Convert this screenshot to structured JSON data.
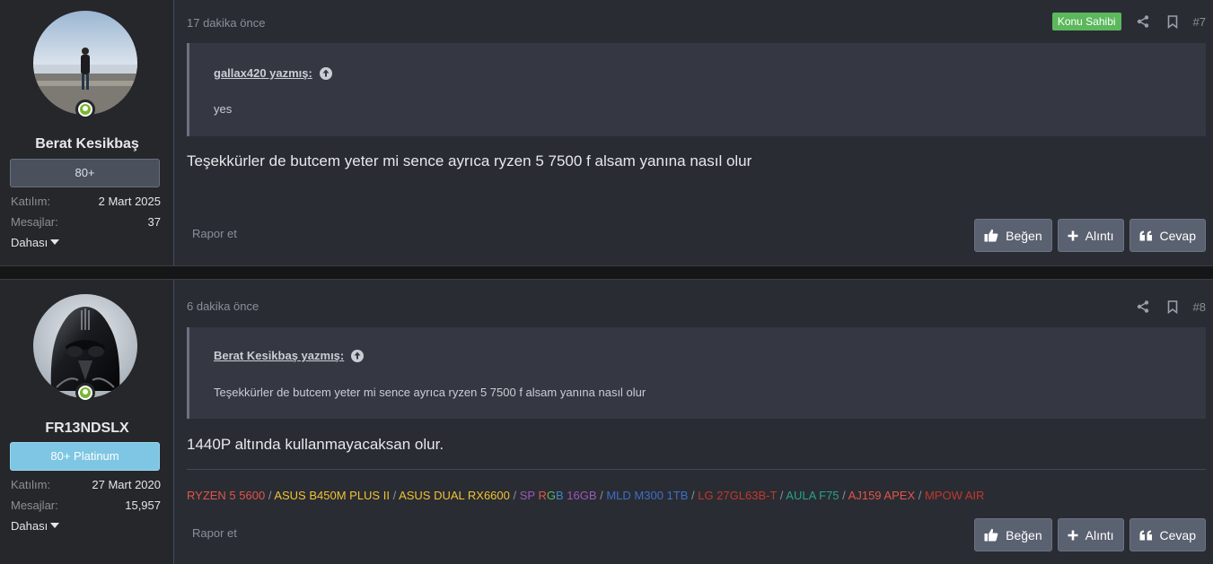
{
  "posts": [
    {
      "user": {
        "name": "Berat Kesikbaş",
        "badge": "80+",
        "join_label": "Katılım:",
        "join_value": "2 Mart 2025",
        "msg_label": "Mesajlar:",
        "msg_value": "37",
        "more": "Dahası"
      },
      "time": "17 dakika önce",
      "owner_badge": "Konu Sahibi",
      "number": "#7",
      "quote": {
        "author": "gallax420 yazmış:",
        "text": "yes"
      },
      "message": "Teşekkürler de butcem yeter mi sence ayrıca ryzen 5 7500 f alsam yanına nasıl olur",
      "report": "Rapor et",
      "actions": {
        "like": "Beğen",
        "quote": "Alıntı",
        "reply": "Cevap"
      }
    },
    {
      "user": {
        "name": "FR13NDSLX",
        "badge": "80+ Platinum",
        "join_label": "Katılım:",
        "join_value": "27 Mart 2020",
        "msg_label": "Mesajlar:",
        "msg_value": "15,957",
        "more": "Dahası"
      },
      "time": "6 dakika önce",
      "number": "#8",
      "quote": {
        "author": "Berat Kesikbaş yazmış:",
        "text": "Teşekkürler de butcem yeter mi sence ayrıca ryzen 5 7500 f alsam yanına nasıl olur"
      },
      "message": "1440P altında kullanmayacaksan olur.",
      "signature": [
        {
          "text": "RYZEN 5 5600",
          "color": "#e0554a"
        },
        {
          "text": "ASUS B450M PLUS II",
          "color": "#f1c232"
        },
        {
          "text": "ASUS DUAL RX6600",
          "color": "#f1c232"
        },
        {
          "text": "SP RGB 16GB",
          "color": "#9b59b6",
          "parts": [
            {
              "text": "SP ",
              "color": "#9b59b6"
            },
            {
              "text": "R",
              "color": "#e0554a"
            },
            {
              "text": "G",
              "color": "#5cb85c"
            },
            {
              "text": "B",
              "color": "#3d85c6"
            },
            {
              "text": " 16GB",
              "color": "#9b59b6"
            }
          ]
        },
        {
          "text": "MLD M300 1TB",
          "color": "#3d6fc6"
        },
        {
          "text": "LG 27GL63B-T",
          "color": "#c0392b"
        },
        {
          "text": "AULA F75",
          "color": "#26a387"
        },
        {
          "text": "AJ159 APEX",
          "color": "#e0554a"
        },
        {
          "text": "MPOW AIR",
          "color": "#c0392b"
        }
      ],
      "separator": "/",
      "report": "Rapor et",
      "actions": {
        "like": "Beğen",
        "quote": "Alıntı",
        "reply": "Cevap"
      }
    }
  ]
}
